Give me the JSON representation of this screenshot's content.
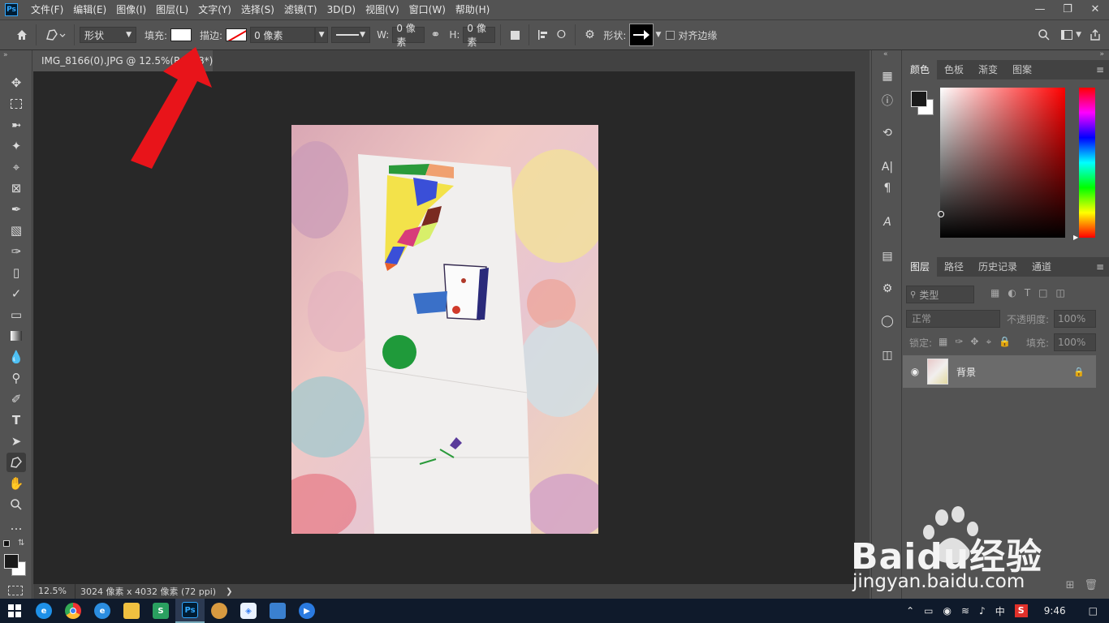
{
  "menubar": {
    "logo": "Ps",
    "items": [
      "文件(F)",
      "编辑(E)",
      "图像(I)",
      "图层(L)",
      "文字(Y)",
      "选择(S)",
      "滤镜(T)",
      "3D(D)",
      "视图(V)",
      "窗口(W)",
      "帮助(H)"
    ]
  },
  "optionbar": {
    "mode": "形状",
    "fill_label": "填充:",
    "stroke_label": "描边:",
    "stroke_width": "0 像素",
    "w_label": "W:",
    "w_value": "0 像素",
    "h_label": "H:",
    "h_value": "0 像素",
    "shape_label": "形状:",
    "align_edges_label": "对齐边缘"
  },
  "document": {
    "tab_title": "IMG_8166(0).JPG @ 12.5%(RGB/8*)"
  },
  "status": {
    "zoom": "12.5%",
    "info": "3024 像素 x 4032 像素 (72 ppi)"
  },
  "color_panel": {
    "tabs": [
      "颜色",
      "色板",
      "渐变",
      "图案"
    ],
    "foreground": "#1a1a1a",
    "background": "#ffffff"
  },
  "layers_panel": {
    "tabs": [
      "图层",
      "路径",
      "历史记录",
      "通道"
    ],
    "filter_label": "类型",
    "blend_mode": "正常",
    "opacity_label": "不透明度:",
    "opacity_value": "100%",
    "lock_label": "锁定:",
    "fill_label": "填充:",
    "fill_value": "100%",
    "layers": [
      {
        "name": "背景",
        "locked": true,
        "visible": true
      }
    ]
  },
  "taskbar": {
    "apps": [
      "ie-icon",
      "chrome-icon",
      "edge-icon",
      "explorer-icon",
      "wps-icon",
      "photoshop-icon",
      "paint-icon",
      "network-icon",
      "gallery-icon",
      "media-icon"
    ],
    "ime": "中",
    "time": "9:46"
  },
  "watermark": {
    "brand": "Baidu经验",
    "url": "jingyan.baidu.com"
  },
  "colors": {
    "accent_red_arrow": "#e8141a",
    "ps_blue": "#31a8ff",
    "panel_bg": "#535353",
    "canvas_bg": "#282828"
  }
}
